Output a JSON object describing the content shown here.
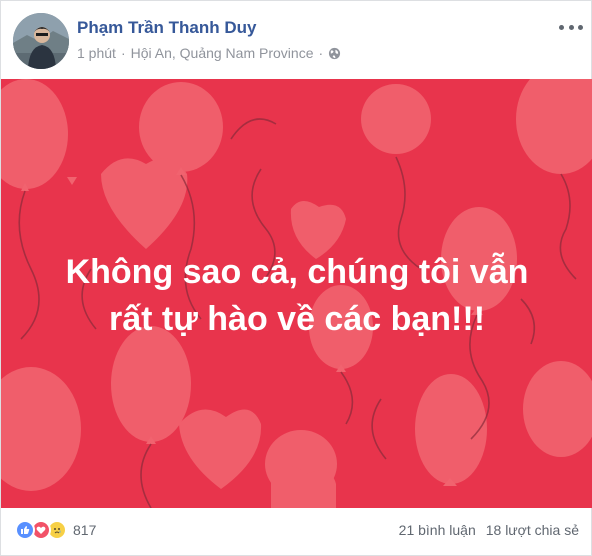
{
  "post": {
    "author": "Phạm Trần Thanh Duy",
    "time": "1 phút",
    "separator": "·",
    "location": "Hội An, Quảng Nam Province",
    "privacy_icon": "globe-icon"
  },
  "banner": {
    "background_color": "#e8344c",
    "line1": "Không sao cả, chúng tôi vẫn",
    "line2": "rất tự hào về các bạn!!!"
  },
  "footer": {
    "reaction_icons": [
      "like-icon",
      "love-icon",
      "sad-icon"
    ],
    "reaction_count": "817",
    "comments": "21 bình luận",
    "shares": "18 lượt chia sẻ"
  }
}
